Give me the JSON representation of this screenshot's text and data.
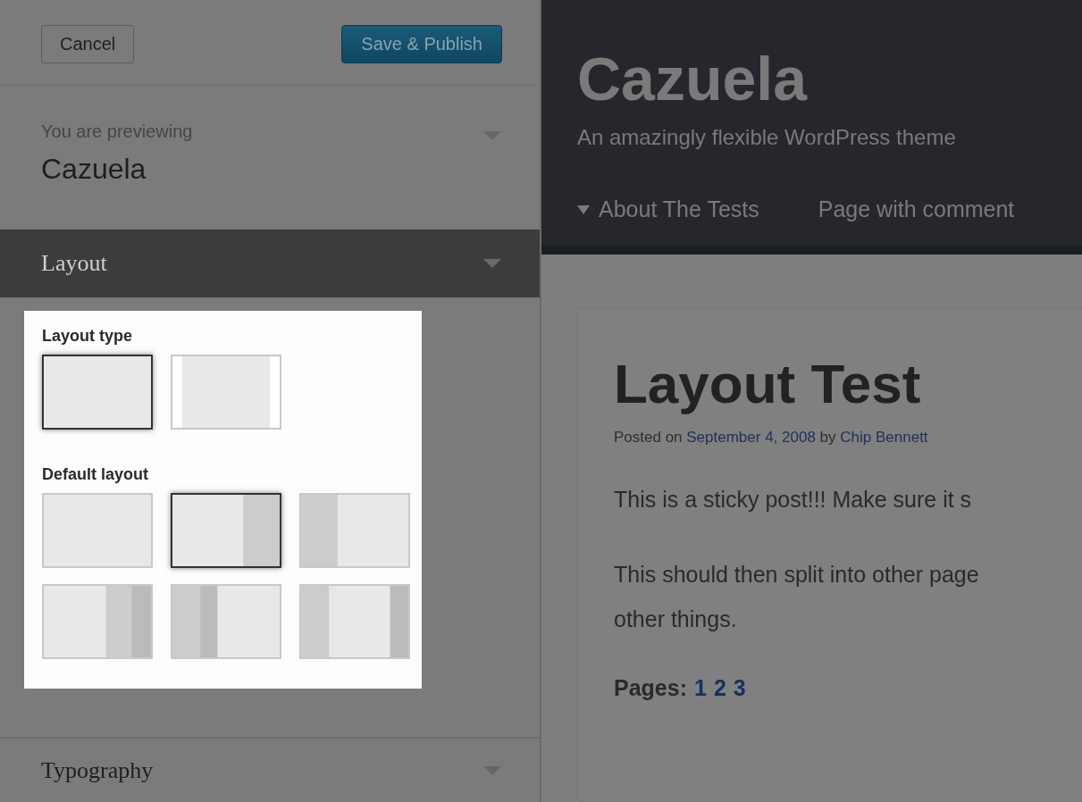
{
  "sidebar": {
    "cancel_button": "Cancel",
    "save_button": "Save & Publish",
    "previewing": {
      "label": "You are previewing",
      "theme": "Cazuela"
    },
    "sections": [
      {
        "title": "Layout",
        "expanded": true
      },
      {
        "title": "Typography",
        "expanded": false
      }
    ],
    "layout_panel": {
      "groups": [
        {
          "title": "Layout type",
          "options": [
            {
              "kind": "full",
              "selected": true
            },
            {
              "kind": "boxed",
              "selected": false
            }
          ]
        },
        {
          "title": "Default layout",
          "options": [
            {
              "kind": "one-column",
              "selected": false
            },
            {
              "kind": "content-sidebar",
              "selected": true
            },
            {
              "kind": "sidebar-content",
              "selected": false
            },
            {
              "kind": "content-sidebar-sidebar",
              "selected": false
            },
            {
              "kind": "sidebar-sidebar-content",
              "selected": false
            },
            {
              "kind": "sidebar-content-sidebar",
              "selected": false
            }
          ]
        }
      ]
    }
  },
  "preview": {
    "site_title": "Cazuela",
    "tagline": "An amazingly flexible WordPress theme",
    "menu": [
      {
        "label": "About The Tests",
        "has_submenu": true
      },
      {
        "label": "Page with comment",
        "has_submenu": false
      }
    ],
    "post": {
      "title": "Layout Test",
      "meta": [
        "Posted on ",
        {
          "link": "September 4, 2008"
        },
        " by ",
        {
          "link": "Chip Bennett"
        }
      ],
      "paragraphs": [
        "This is a sticky post!!! Make sure it s",
        "This should then split into other page\nother things."
      ],
      "pages_label": "Pages:",
      "pages": [
        "1",
        "2",
        "3"
      ]
    }
  }
}
